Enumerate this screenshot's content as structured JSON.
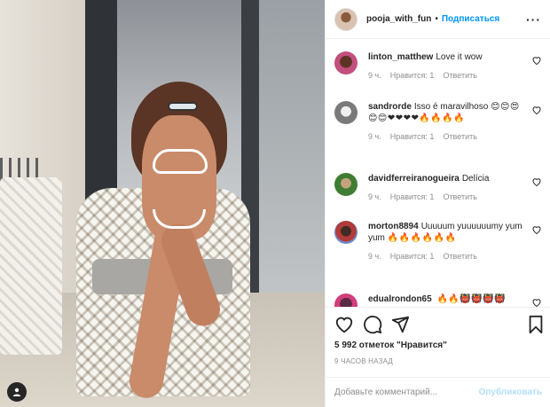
{
  "header": {
    "username": "pooja_with_fun",
    "separator": "•",
    "follow_label": "Подписаться",
    "more_label": "···"
  },
  "comments": [
    {
      "username": "linton_matthew",
      "text": "Love it wow",
      "time": "9 ч.",
      "likes": "Нравится: 1",
      "reply": "Ответить",
      "avatar_icon": "avatar-icon"
    },
    {
      "username": "sandrorde",
      "text": "Isso é maravilhoso",
      "emoji": "😊😊😍😊😊❤❤❤❤🔥🔥🔥🔥",
      "time": "9 ч.",
      "likes": "Нравится: 1",
      "reply": "Ответить",
      "avatar_icon": "avatar-icon"
    },
    {
      "username": "davidferreiranogueira",
      "text": "Delícia",
      "time": "9 ч.",
      "likes": "Нравится: 1",
      "reply": "Ответить",
      "avatar_icon": "avatar-icon"
    },
    {
      "username": "morton8894",
      "text": "Uuuuum yuuuuuumy yum yum",
      "emoji": "🔥🔥🔥🔥🔥🔥",
      "time": "9 ч.",
      "likes": "Нравится: 1",
      "reply": "Ответить",
      "avatar_icon": "avatar-icon"
    },
    {
      "username": "edualrondon65",
      "emoji": "🔥🔥👹👹👹👹",
      "avatar_icon": "avatar-icon"
    }
  ],
  "actions": {
    "likes_text": "5 992 отметок \"Нравится\"",
    "time_ago": "9 ЧАСОВ НАЗАД",
    "icons": [
      "heart-icon",
      "comment-icon",
      "share-icon",
      "bookmark-icon"
    ]
  },
  "add_comment": {
    "placeholder": "Добавьте комментарий...",
    "publish_label": "Опубликовать"
  },
  "colors": {
    "link_blue": "#0095f6",
    "publish_disabled": "#b2dffc",
    "text": "#262626",
    "muted": "#8e8e8e"
  }
}
